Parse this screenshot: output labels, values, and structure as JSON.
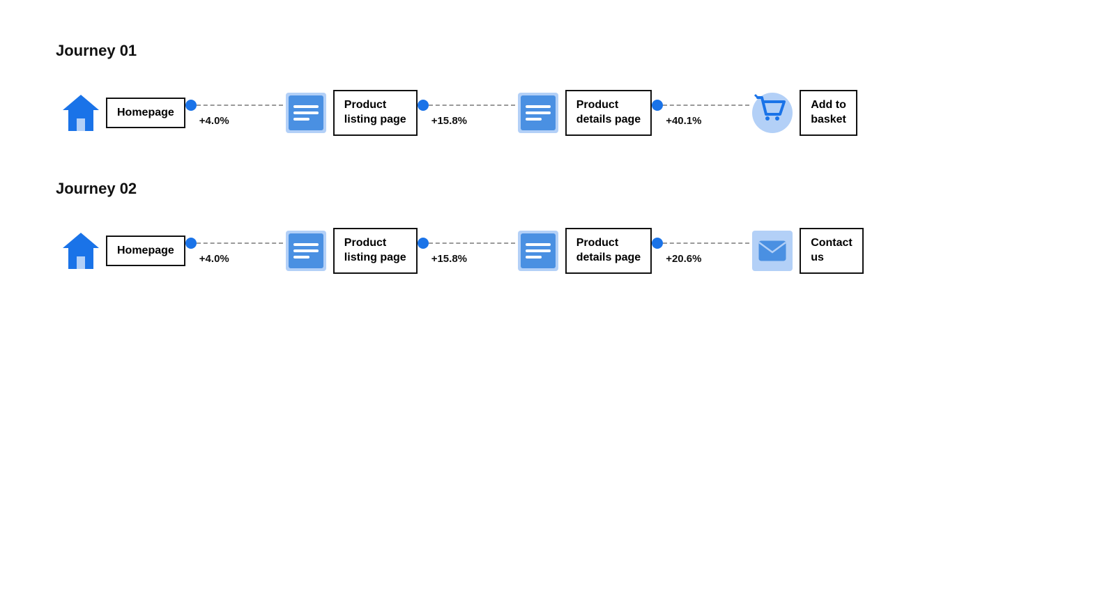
{
  "journeys": [
    {
      "id": "journey-01",
      "title": "Journey 01",
      "nodes": [
        {
          "id": "homepage-1",
          "icon": "home",
          "label": "Homepage",
          "label_lines": [
            "Homepage"
          ]
        },
        {
          "id": "product-listing-1",
          "icon": "listing",
          "label": "Product listing page",
          "label_lines": [
            "Product",
            "listing page"
          ]
        },
        {
          "id": "product-details-1",
          "icon": "listing",
          "label": "Product details page",
          "label_lines": [
            "Product",
            "details page"
          ]
        },
        {
          "id": "add-basket-1",
          "icon": "cart",
          "label": "Add to basket",
          "label_lines": [
            "Add to",
            "basket"
          ]
        }
      ],
      "connectors": [
        {
          "id": "c1-1",
          "pct": "+4.0%"
        },
        {
          "id": "c1-2",
          "pct": "+15.8%"
        },
        {
          "id": "c1-3",
          "pct": "+40.1%"
        }
      ]
    },
    {
      "id": "journey-02",
      "title": "Journey 02",
      "nodes": [
        {
          "id": "homepage-2",
          "icon": "home",
          "label": "Homepage",
          "label_lines": [
            "Homepage"
          ]
        },
        {
          "id": "product-listing-2",
          "icon": "listing",
          "label": "Product listing page",
          "label_lines": [
            "Product",
            "listing page"
          ]
        },
        {
          "id": "product-details-2",
          "icon": "listing",
          "label": "Product details page",
          "label_lines": [
            "Product",
            "details page"
          ]
        },
        {
          "id": "contact-us-2",
          "icon": "email",
          "label": "Contact us",
          "label_lines": [
            "Contact",
            "us"
          ]
        }
      ],
      "connectors": [
        {
          "id": "c2-1",
          "pct": "+4.0%"
        },
        {
          "id": "c2-2",
          "pct": "+15.8%"
        },
        {
          "id": "c2-3",
          "pct": "+20.6%"
        }
      ]
    }
  ],
  "icons": {
    "home": "🏠",
    "listing": "📋",
    "cart": "🛒",
    "email": "✉️"
  }
}
